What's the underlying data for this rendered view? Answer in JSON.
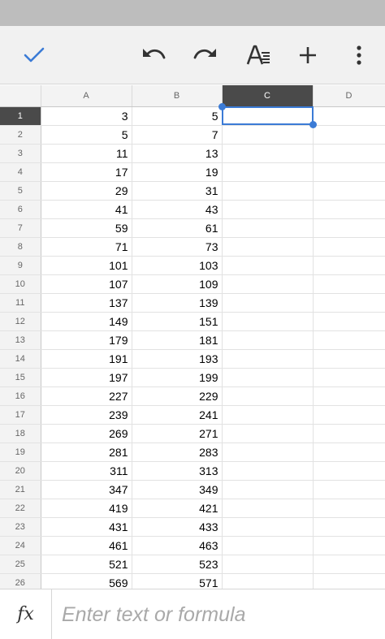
{
  "toolbar": {
    "icons": [
      "check-icon",
      "undo-icon",
      "redo-icon",
      "text-format-icon",
      "plus-icon",
      "more-vert-icon"
    ],
    "accent_color": "#3b7bd6"
  },
  "sheet": {
    "columns": [
      "A",
      "B",
      "C",
      "D"
    ],
    "selected_column": "C",
    "selected_cell": "C1",
    "rows": [
      {
        "n": "1",
        "a": "3",
        "b": "5"
      },
      {
        "n": "2",
        "a": "5",
        "b": "7"
      },
      {
        "n": "3",
        "a": "11",
        "b": "13"
      },
      {
        "n": "4",
        "a": "17",
        "b": "19"
      },
      {
        "n": "5",
        "a": "29",
        "b": "31"
      },
      {
        "n": "6",
        "a": "41",
        "b": "43"
      },
      {
        "n": "7",
        "a": "59",
        "b": "61"
      },
      {
        "n": "8",
        "a": "71",
        "b": "73"
      },
      {
        "n": "9",
        "a": "101",
        "b": "103"
      },
      {
        "n": "10",
        "a": "107",
        "b": "109"
      },
      {
        "n": "11",
        "a": "137",
        "b": "139"
      },
      {
        "n": "12",
        "a": "149",
        "b": "151"
      },
      {
        "n": "13",
        "a": "179",
        "b": "181"
      },
      {
        "n": "14",
        "a": "191",
        "b": "193"
      },
      {
        "n": "15",
        "a": "197",
        "b": "199"
      },
      {
        "n": "16",
        "a": "227",
        "b": "229"
      },
      {
        "n": "17",
        "a": "239",
        "b": "241"
      },
      {
        "n": "18",
        "a": "269",
        "b": "271"
      },
      {
        "n": "19",
        "a": "281",
        "b": "283"
      },
      {
        "n": "20",
        "a": "311",
        "b": "313"
      },
      {
        "n": "21",
        "a": "347",
        "b": "349"
      },
      {
        "n": "22",
        "a": "419",
        "b": "421"
      },
      {
        "n": "23",
        "a": "431",
        "b": "433"
      },
      {
        "n": "24",
        "a": "461",
        "b": "463"
      },
      {
        "n": "25",
        "a": "521",
        "b": "523"
      },
      {
        "n": "26",
        "a": "569",
        "b": "571"
      }
    ]
  },
  "formula_bar": {
    "label": "fx",
    "placeholder": "Enter text or formula",
    "value": ""
  }
}
